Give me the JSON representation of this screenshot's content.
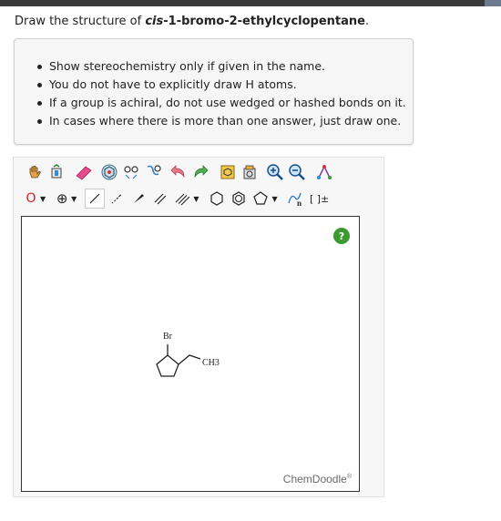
{
  "question": {
    "prefix": "Draw the structure of ",
    "stereo": "cis",
    "rest": "-1-bromo-2-ethylcyclopentane",
    "suffix": "."
  },
  "instructions": [
    "Show stereochemistry only if given in the name.",
    "You do not have to explicitly draw H atoms.",
    "If a group is achiral, do not use wedged or hashed bonds on it.",
    "In cases where there is more than one answer, just draw one."
  ],
  "toolbar": {
    "element_label": "O",
    "charge_label": "⊕",
    "bracket_label": "[ ]±",
    "sn_label": "n"
  },
  "canvas": {
    "help_label": "?",
    "brand": "ChemDoodle",
    "brand_mark": "®",
    "atom_br": "Br",
    "atom_ch3": "CH3"
  }
}
